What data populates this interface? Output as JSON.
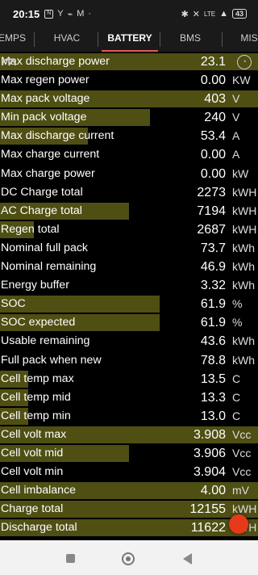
{
  "status_bar": {
    "time": "20:15",
    "left_icons": [
      "N",
      "Y",
      "⌁",
      "M",
      "·"
    ],
    "right_icons": [
      "✱",
      "✕",
      "LTE",
      "▲"
    ],
    "battery": "43"
  },
  "tabs": [
    {
      "label": "EMPS"
    },
    {
      "label": "HVAC"
    },
    {
      "label": "BATTERY"
    },
    {
      "label": "BMS"
    },
    {
      "label": "MIS"
    }
  ],
  "rows": [
    {
      "label": "Max discharge power",
      "value": "23.1",
      "unit": "",
      "bar": 1.0
    },
    {
      "label": "Max regen power",
      "value": "0.00",
      "unit": "KW",
      "bar": 0
    },
    {
      "label": "Max pack voltage",
      "value": "403",
      "unit": "V",
      "bar": 1.0
    },
    {
      "label": "Min pack voltage",
      "value": "240",
      "unit": "V",
      "bar": 0.58
    },
    {
      "label": "Max discharge current",
      "value": "53.4",
      "unit": "A",
      "bar": 0.34
    },
    {
      "label": "Max charge current",
      "value": "0.00",
      "unit": "A",
      "bar": 0
    },
    {
      "label": "Max charge power",
      "value": "0.00",
      "unit": "kW",
      "bar": 0
    },
    {
      "label": "DC Charge total",
      "value": "2273",
      "unit": "kWH",
      "bar": 0
    },
    {
      "label": "AC Charge total",
      "value": "7194",
      "unit": "kWH",
      "bar": 0.5
    },
    {
      "label": "Regen total",
      "value": "2687",
      "unit": "kWH",
      "bar": 0.13
    },
    {
      "label": "Nominal full pack",
      "value": "73.7",
      "unit": "kWh",
      "bar": 0
    },
    {
      "label": "Nominal remaining",
      "value": "46.9",
      "unit": "kWh",
      "bar": 0
    },
    {
      "label": "Energy buffer",
      "value": "3.32",
      "unit": "kWh",
      "bar": 0
    },
    {
      "label": "SOC",
      "value": "61.9",
      "unit": "%",
      "bar": 0.62
    },
    {
      "label": "SOC expected",
      "value": "61.9",
      "unit": "%",
      "bar": 0.62
    },
    {
      "label": "Usable remaining",
      "value": "43.6",
      "unit": "kWh",
      "bar": 0
    },
    {
      "label": "Full pack when new",
      "value": "78.8",
      "unit": "kWh",
      "bar": 0
    },
    {
      "label": "Cell temp max",
      "value": "13.5",
      "unit": "C",
      "bar": 0.11
    },
    {
      "label": "Cell temp mid",
      "value": "13.3",
      "unit": "C",
      "bar": 0.11
    },
    {
      "label": "Cell temp min",
      "value": "13.0",
      "unit": "C",
      "bar": 0.11
    },
    {
      "label": "Cell volt max",
      "value": "3.908",
      "unit": "Vcc",
      "bar": 1.0
    },
    {
      "label": "Cell volt mid",
      "value": "3.906",
      "unit": "Vcc",
      "bar": 0.5
    },
    {
      "label": "Cell volt min",
      "value": "3.904",
      "unit": "Vcc",
      "bar": 0
    },
    {
      "label": "Cell imbalance",
      "value": "4.00",
      "unit": "mV",
      "bar": 1.0
    },
    {
      "label": "Charge total",
      "value": "12155",
      "unit": "kWH",
      "bar": 1.0
    },
    {
      "label": "Discharge total",
      "value": "11622",
      "unit": "kWH",
      "bar": 1.0
    },
    {
      "label": "",
      "value": "",
      "unit": "",
      "bar": 0
    }
  ],
  "colors": {
    "bar_fill": "#4f4f14",
    "active_tab_underline": "#e05a5a",
    "fab": "#e53a1a"
  },
  "icons": {
    "gauge_left": "speedometer-icon",
    "gauge_right": "gauge-badge-icon",
    "fab": "record-icon"
  }
}
